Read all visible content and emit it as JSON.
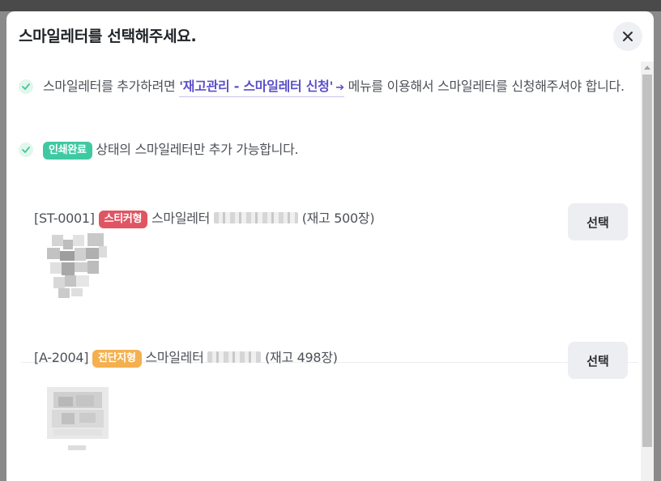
{
  "modal": {
    "title": "스마일레터를 선택해주세요."
  },
  "notices": [
    {
      "before": "스마일레터를 추가하려면 ",
      "link": "'재고관리 - 스마일레터 신청'",
      "after": " 메뉴를 이용해서 스마일레터를 신청해주셔야 합니다."
    },
    {
      "badge": "인쇄완료",
      "text": " 상태의 스마일레터만 추가 가능합니다."
    }
  ],
  "items": [
    {
      "code": "[ST-0001]",
      "type_badge": "스티커형",
      "name_prefix": "스마일레터",
      "stock": "(재고 500장)",
      "button": "선택"
    },
    {
      "code": "[A-2004]",
      "type_badge": "전단지형",
      "name_prefix": "스마일레터",
      "stock": "(재고 498장)",
      "button": "선택"
    }
  ],
  "colors": {
    "accent": "#5b50c8",
    "badge_printed": "#3fc9a2",
    "badge_sticker": "#e05563",
    "badge_flyer": "#f4b04e"
  },
  "icons": {
    "close": "close-icon",
    "check": "check-icon",
    "arrow": "arrow-right-icon"
  }
}
